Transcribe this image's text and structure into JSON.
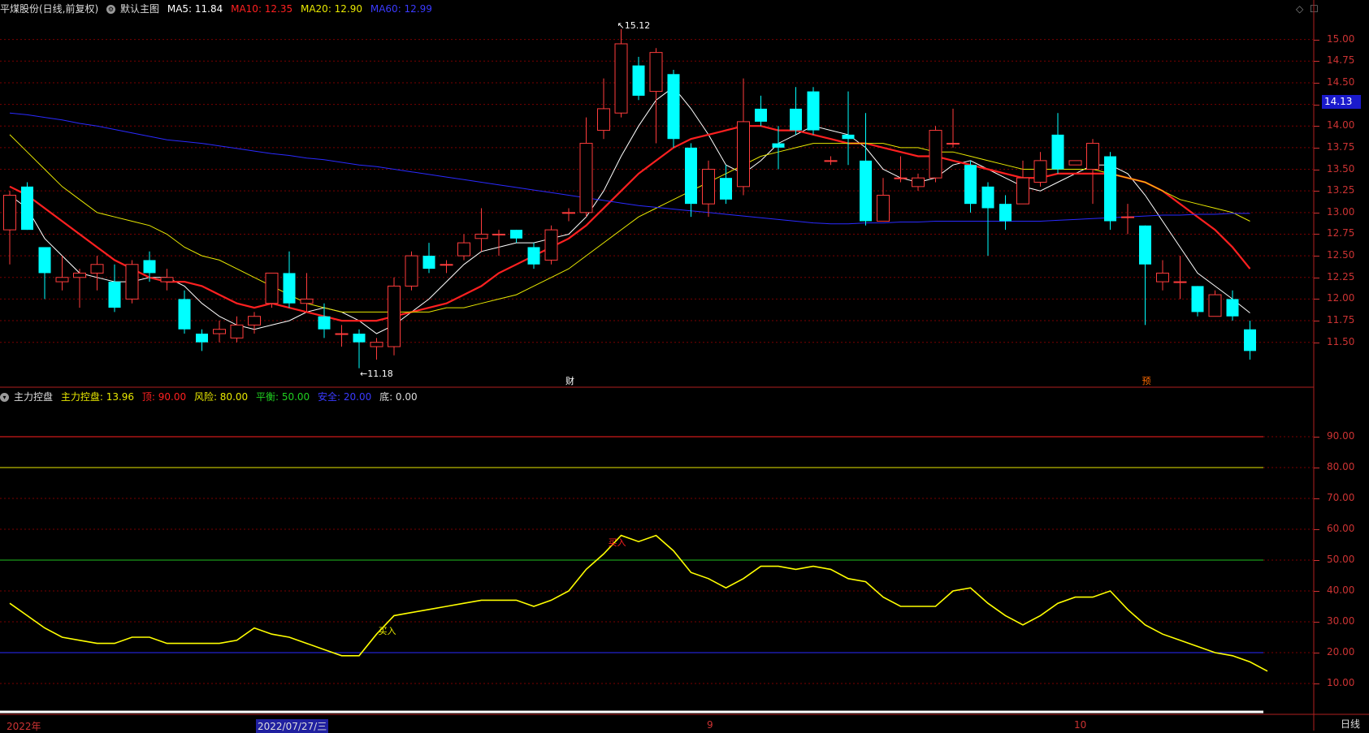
{
  "main_header": {
    "stock": "平煤股份(日线,前复权)",
    "template": "默认主图",
    "ma5": "MA5: 11.84",
    "ma10": "MA10: 12.35",
    "ma20": "MA20: 12.90",
    "ma60": "MA60: 12.99"
  },
  "ind_header": {
    "name": "主力控盘",
    "main": "主力控盘: 13.96",
    "top": "顶: 90.00",
    "risk": "风险: 80.00",
    "balance": "平衡: 50.00",
    "safe": "安全: 20.00",
    "bottom": "底: 0.00"
  },
  "colors": {
    "up": "#ff3c3c",
    "down": "#00ffff",
    "ma5": "#ffffff",
    "ma10": "#ff2020",
    "ma20": "#e8e800",
    "ma60": "#2a2aff",
    "grid": "#7a0000",
    "axis": "#c33"
  },
  "chart_data": [
    {
      "type": "candlestick",
      "title": "平煤股份(日线,前复权)",
      "ylim": [
        11.0,
        15.25
      ],
      "yticks": [
        "15.00",
        "14.75",
        "14.50",
        "14.25",
        "14.00",
        "13.75",
        "13.50",
        "13.25",
        "13.00",
        "12.75",
        "12.50",
        "12.25",
        "12.00",
        "11.75",
        "11.50"
      ],
      "last_price": "14.13",
      "high_label": "15.12",
      "low_label": "11.18",
      "candles": [
        [
          12.8,
          13.2,
          12.4,
          13.25
        ],
        [
          13.3,
          12.8,
          12.8,
          13.35
        ],
        [
          12.6,
          12.3,
          12.0,
          12.6
        ],
        [
          12.2,
          12.25,
          12.1,
          12.5
        ],
        [
          12.25,
          12.3,
          11.9,
          12.35
        ],
        [
          12.3,
          12.4,
          12.1,
          12.5
        ],
        [
          12.2,
          11.9,
          11.85,
          12.4
        ],
        [
          12.0,
          12.4,
          11.95,
          12.45
        ],
        [
          12.45,
          12.3,
          12.2,
          12.55
        ],
        [
          12.2,
          12.25,
          12.1,
          12.35
        ],
        [
          12.0,
          11.65,
          11.6,
          12.1
        ],
        [
          11.6,
          11.5,
          11.4,
          11.65
        ],
        [
          11.6,
          11.65,
          11.5,
          11.75
        ],
        [
          11.55,
          11.7,
          11.5,
          11.8
        ],
        [
          11.7,
          11.8,
          11.6,
          11.85
        ],
        [
          11.95,
          12.3,
          11.9,
          12.3
        ],
        [
          12.3,
          11.95,
          11.9,
          12.55
        ],
        [
          11.95,
          12.0,
          11.85,
          12.3
        ],
        [
          11.8,
          11.65,
          11.55,
          11.95
        ],
        [
          11.6,
          11.6,
          11.45,
          11.7
        ],
        [
          11.6,
          11.5,
          11.2,
          11.65
        ],
        [
          11.45,
          11.5,
          11.3,
          11.55
        ],
        [
          11.45,
          12.15,
          11.35,
          12.25
        ],
        [
          12.15,
          12.5,
          12.1,
          12.55
        ],
        [
          12.5,
          12.35,
          12.3,
          12.65
        ],
        [
          12.4,
          12.4,
          12.3,
          12.45
        ],
        [
          12.5,
          12.65,
          12.45,
          12.75
        ],
        [
          12.7,
          12.75,
          12.55,
          13.05
        ],
        [
          12.75,
          12.75,
          12.5,
          12.8
        ],
        [
          12.8,
          12.7,
          12.65,
          12.8
        ],
        [
          12.6,
          12.4,
          12.35,
          12.65
        ],
        [
          12.45,
          12.8,
          12.4,
          12.85
        ],
        [
          13.0,
          13.0,
          12.9,
          13.05
        ],
        [
          13.0,
          13.8,
          12.95,
          14.1
        ],
        [
          13.95,
          14.2,
          13.85,
          14.55
        ],
        [
          14.15,
          14.95,
          14.1,
          15.12
        ],
        [
          14.7,
          14.35,
          14.3,
          14.8
        ],
        [
          14.4,
          14.85,
          13.8,
          14.9
        ],
        [
          14.6,
          13.85,
          13.75,
          14.65
        ],
        [
          13.75,
          13.1,
          12.95,
          13.8
        ],
        [
          13.1,
          13.5,
          12.95,
          13.6
        ],
        [
          13.4,
          13.15,
          13.1,
          13.55
        ],
        [
          13.3,
          14.05,
          13.2,
          14.55
        ],
        [
          14.2,
          14.05,
          14.0,
          14.35
        ],
        [
          13.8,
          13.75,
          13.5,
          14.0
        ],
        [
          14.2,
          13.95,
          13.9,
          14.45
        ],
        [
          14.4,
          13.95,
          13.9,
          14.45
        ],
        [
          13.6,
          13.6,
          13.55,
          13.65
        ],
        [
          13.9,
          13.85,
          13.55,
          14.4
        ],
        [
          13.6,
          12.9,
          12.85,
          14.15
        ],
        [
          12.9,
          13.2,
          12.9,
          13.4
        ],
        [
          13.4,
          13.4,
          13.35,
          13.65
        ],
        [
          13.3,
          13.4,
          13.25,
          13.45
        ],
        [
          13.4,
          13.95,
          13.35,
          14.0
        ],
        [
          13.8,
          13.8,
          13.75,
          14.2
        ],
        [
          13.55,
          13.1,
          13.0,
          13.6
        ],
        [
          13.3,
          13.05,
          12.5,
          13.35
        ],
        [
          13.1,
          12.9,
          12.8,
          13.2
        ],
        [
          13.1,
          13.4,
          13.1,
          13.6
        ],
        [
          13.35,
          13.6,
          13.3,
          13.7
        ],
        [
          13.9,
          13.5,
          13.45,
          14.15
        ],
        [
          13.55,
          13.6,
          13.55,
          13.6
        ],
        [
          13.5,
          13.8,
          13.1,
          13.85
        ],
        [
          13.65,
          12.9,
          12.8,
          13.7
        ],
        [
          12.95,
          12.95,
          12.75,
          13.1
        ],
        [
          12.85,
          12.4,
          11.7,
          12.85
        ],
        [
          12.2,
          12.3,
          12.1,
          12.45
        ],
        [
          12.2,
          12.2,
          12.0,
          12.5
        ],
        [
          12.15,
          11.85,
          11.8,
          12.15
        ],
        [
          11.8,
          12.05,
          11.8,
          12.1
        ],
        [
          12.0,
          11.8,
          11.75,
          12.1
        ],
        [
          11.65,
          11.4,
          11.3,
          11.75
        ]
      ],
      "series": [
        {
          "name": "MA5",
          "values": [
            13.2,
            13.05,
            12.7,
            12.5,
            12.3,
            12.25,
            12.2,
            12.2,
            12.25,
            12.25,
            12.15,
            11.95,
            11.8,
            11.7,
            11.65,
            11.7,
            11.75,
            11.85,
            11.9,
            11.85,
            11.75,
            11.6,
            11.7,
            11.85,
            12.0,
            12.2,
            12.4,
            12.55,
            12.6,
            12.65,
            12.65,
            12.7,
            12.75,
            12.95,
            13.25,
            13.65,
            14.0,
            14.3,
            14.45,
            14.2,
            13.9,
            13.55,
            13.45,
            13.6,
            13.8,
            13.9,
            14.0,
            13.95,
            13.9,
            13.75,
            13.5,
            13.4,
            13.35,
            13.4,
            13.55,
            13.6,
            13.5,
            13.4,
            13.3,
            13.25,
            13.35,
            13.45,
            13.55,
            13.55,
            13.45,
            13.2,
            12.9,
            12.6,
            12.3,
            12.15,
            12.0,
            11.84
          ]
        },
        {
          "name": "MA10",
          "values": [
            13.3,
            13.2,
            13.05,
            12.9,
            12.75,
            12.6,
            12.45,
            12.35,
            12.25,
            12.2,
            12.2,
            12.15,
            12.05,
            11.95,
            11.9,
            11.95,
            11.9,
            11.85,
            11.8,
            11.75,
            11.75,
            11.75,
            11.8,
            11.85,
            11.9,
            11.95,
            12.05,
            12.15,
            12.3,
            12.4,
            12.5,
            12.6,
            12.7,
            12.85,
            13.05,
            13.25,
            13.45,
            13.6,
            13.75,
            13.85,
            13.9,
            13.95,
            14.0,
            14.0,
            13.95,
            13.95,
            13.9,
            13.85,
            13.8,
            13.8,
            13.75,
            13.7,
            13.65,
            13.65,
            13.6,
            13.55,
            13.5,
            13.45,
            13.4,
            13.4,
            13.45,
            13.45,
            13.45,
            13.45,
            13.4,
            13.35,
            13.25,
            13.1,
            12.95,
            12.8,
            12.6,
            12.35
          ]
        },
        {
          "name": "MA20",
          "values": [
            13.9,
            13.7,
            13.5,
            13.3,
            13.15,
            13.0,
            12.95,
            12.9,
            12.85,
            12.75,
            12.6,
            12.5,
            12.45,
            12.35,
            12.25,
            12.15,
            12.05,
            11.95,
            11.9,
            11.85,
            11.85,
            11.85,
            11.85,
            11.85,
            11.85,
            11.9,
            11.9,
            11.95,
            12.0,
            12.05,
            12.15,
            12.25,
            12.35,
            12.5,
            12.65,
            12.8,
            12.95,
            13.05,
            13.15,
            13.25,
            13.35,
            13.45,
            13.55,
            13.65,
            13.7,
            13.75,
            13.8,
            13.8,
            13.8,
            13.8,
            13.8,
            13.75,
            13.75,
            13.7,
            13.7,
            13.65,
            13.6,
            13.55,
            13.5,
            13.5,
            13.5,
            13.5,
            13.5,
            13.45,
            13.4,
            13.35,
            13.25,
            13.15,
            13.1,
            13.05,
            13.0,
            12.9
          ]
        },
        {
          "name": "MA60",
          "values": [
            14.15,
            14.13,
            14.1,
            14.07,
            14.03,
            14.0,
            13.96,
            13.92,
            13.88,
            13.84,
            13.82,
            13.8,
            13.77,
            13.74,
            13.71,
            13.68,
            13.66,
            13.63,
            13.61,
            13.58,
            13.55,
            13.53,
            13.5,
            13.47,
            13.44,
            13.41,
            13.38,
            13.35,
            13.32,
            13.29,
            13.26,
            13.23,
            13.2,
            13.17,
            13.14,
            13.11,
            13.08,
            13.06,
            13.04,
            13.02,
            13.0,
            12.98,
            12.96,
            12.94,
            12.92,
            12.9,
            12.88,
            12.87,
            12.87,
            12.88,
            12.88,
            12.89,
            12.89,
            12.9,
            12.9,
            12.9,
            12.9,
            12.9,
            12.9,
            12.9,
            12.91,
            12.92,
            12.93,
            12.94,
            12.95,
            12.96,
            12.97,
            12.97,
            12.98,
            12.98,
            12.99,
            12.99
          ]
        }
      ],
      "annotations": [
        "财",
        "预"
      ]
    },
    {
      "type": "line",
      "title": "主力控盘",
      "ylim": [
        0,
        100
      ],
      "yticks": [
        "90.00",
        "80.00",
        "70.00",
        "60.00",
        "50.00",
        "40.00",
        "30.00",
        "20.00",
        "10.00"
      ],
      "levels": [
        {
          "name": "顶",
          "value": 90
        },
        {
          "name": "风险",
          "value": 80
        },
        {
          "name": "平衡",
          "value": 50
        },
        {
          "name": "安全",
          "value": 20
        },
        {
          "name": "底",
          "value": 0
        }
      ],
      "series": [
        {
          "name": "主力控盘",
          "values": [
            36,
            32,
            28,
            25,
            24,
            23,
            23,
            25,
            25,
            23,
            23,
            23,
            23,
            24,
            28,
            26,
            25,
            23,
            21,
            19,
            19,
            26,
            32,
            33,
            34,
            35,
            36,
            37,
            37,
            37,
            35,
            37,
            40,
            47,
            52,
            58,
            56,
            58,
            53,
            46,
            44,
            41,
            44,
            48,
            48,
            47,
            48,
            47,
            44,
            43,
            38,
            35,
            35,
            35,
            40,
            41,
            36,
            32,
            29,
            32,
            36,
            38,
            38,
            40,
            34,
            29,
            26,
            24,
            22,
            20,
            19,
            17,
            14
          ]
        }
      ],
      "buy_signals": [
        {
          "label": "买入",
          "index": 21
        },
        {
          "label": "买入",
          "index": 35
        }
      ]
    }
  ],
  "x_axis": {
    "labels": [
      "2022年",
      "2022/07/27/三",
      "9",
      "10"
    ]
  },
  "period_button": "日线"
}
